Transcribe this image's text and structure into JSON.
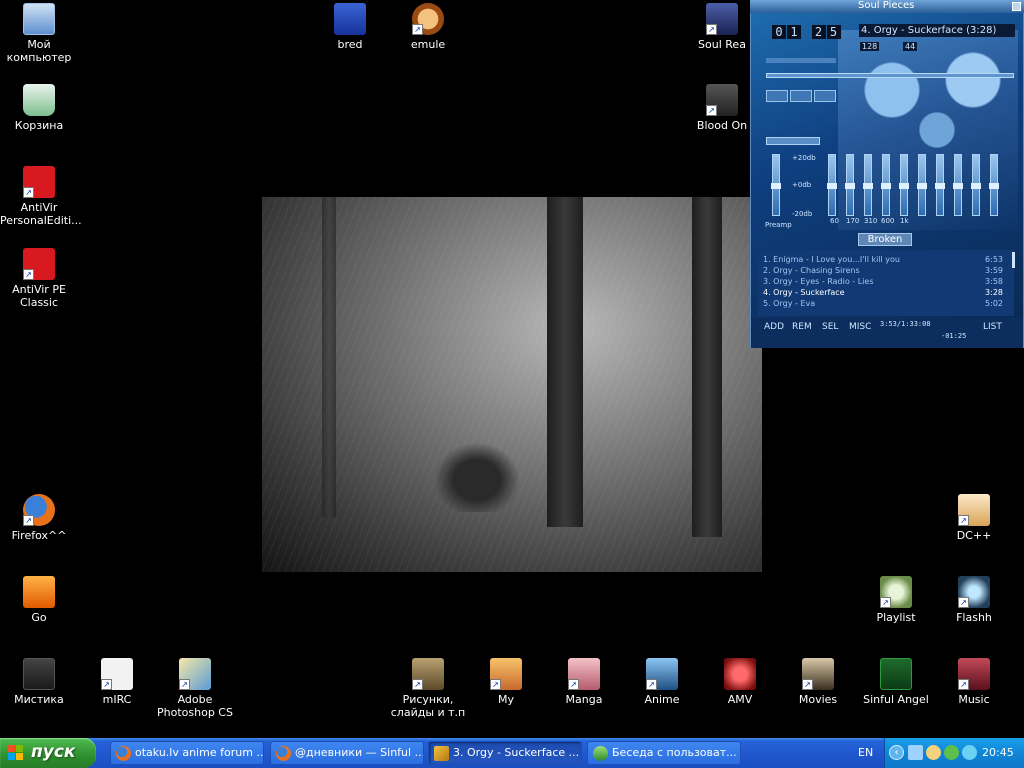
{
  "desktop": {
    "left_icons": [
      {
        "label": "Мой компьютер"
      },
      {
        "label": "Корзина"
      },
      {
        "label": "AntiVir PersonalEditi..."
      },
      {
        "label": "AntiVir PE Classic"
      },
      {
        "label": "Firefox^^"
      },
      {
        "label": "Go"
      }
    ],
    "top_icons": [
      {
        "label": "bred"
      },
      {
        "label": "emule"
      },
      {
        "label": "Soul Rea"
      },
      {
        "label": "Blood On"
      }
    ],
    "right_icons": [
      {
        "label": "DC++"
      },
      {
        "label": "Playlist"
      },
      {
        "label": "Flashh"
      }
    ],
    "bottom_icons": [
      {
        "label": "Мистика"
      },
      {
        "label": "mIRC"
      },
      {
        "label": "Adobe Photoshop CS"
      },
      {
        "label": "Рисунки, слайды и т.п"
      },
      {
        "label": "My"
      },
      {
        "label": "Manga"
      },
      {
        "label": "Anime"
      },
      {
        "label": "AMV"
      },
      {
        "label": "Movies"
      },
      {
        "label": "Sinful Angel"
      },
      {
        "label": "Music"
      }
    ]
  },
  "winamp": {
    "title": "Soul Pieces",
    "time_digits": [
      "0",
      "1",
      "2",
      "5"
    ],
    "track": "4. Orgy - Suckerface (3:28)",
    "kbps": "128",
    "khz": "44",
    "eq_labels": {
      "top": "+20db",
      "mid": "+0db",
      "bottom": "-20db",
      "preamp": "Preamp"
    },
    "eq_freqs": [
      "60",
      "170",
      "310",
      "600",
      "1k"
    ],
    "playlist_title": "Broken",
    "playlist": [
      {
        "title": "1. Enigma - I Love you...I'll kill you",
        "duration": "6:53"
      },
      {
        "title": "2. Orgy - Chasing Sirens",
        "duration": "3:59"
      },
      {
        "title": "3. Orgy - Eyes - Radio - Lies",
        "duration": "3:58"
      },
      {
        "title": "4. Orgy - Suckerface",
        "duration": "3:28"
      },
      {
        "title": "5. Orgy - Eva",
        "duration": "5:02"
      }
    ],
    "buttons": {
      "add": "ADD",
      "rem": "REM",
      "sel": "SEL",
      "misc": "MISC",
      "list": "LIST"
    },
    "total_time": "3:53/1:33:08",
    "remaining": "-01:25"
  },
  "taskbar": {
    "start_label": "пуск",
    "tasks": [
      {
        "label": "otaku.lv anime forum ..."
      },
      {
        "label": "@дневники — Sinful ..."
      },
      {
        "label": "3. Orgy - Suckerface ..."
      },
      {
        "label": "Беседа с пользоват..."
      }
    ],
    "language": "EN",
    "clock": "20:45"
  },
  "colors": {
    "taskbar_blue": "#2158cf",
    "start_green": "#2e8e2e",
    "tray_blue": "#1086d8",
    "winamp_blue": "#0f3f80"
  }
}
